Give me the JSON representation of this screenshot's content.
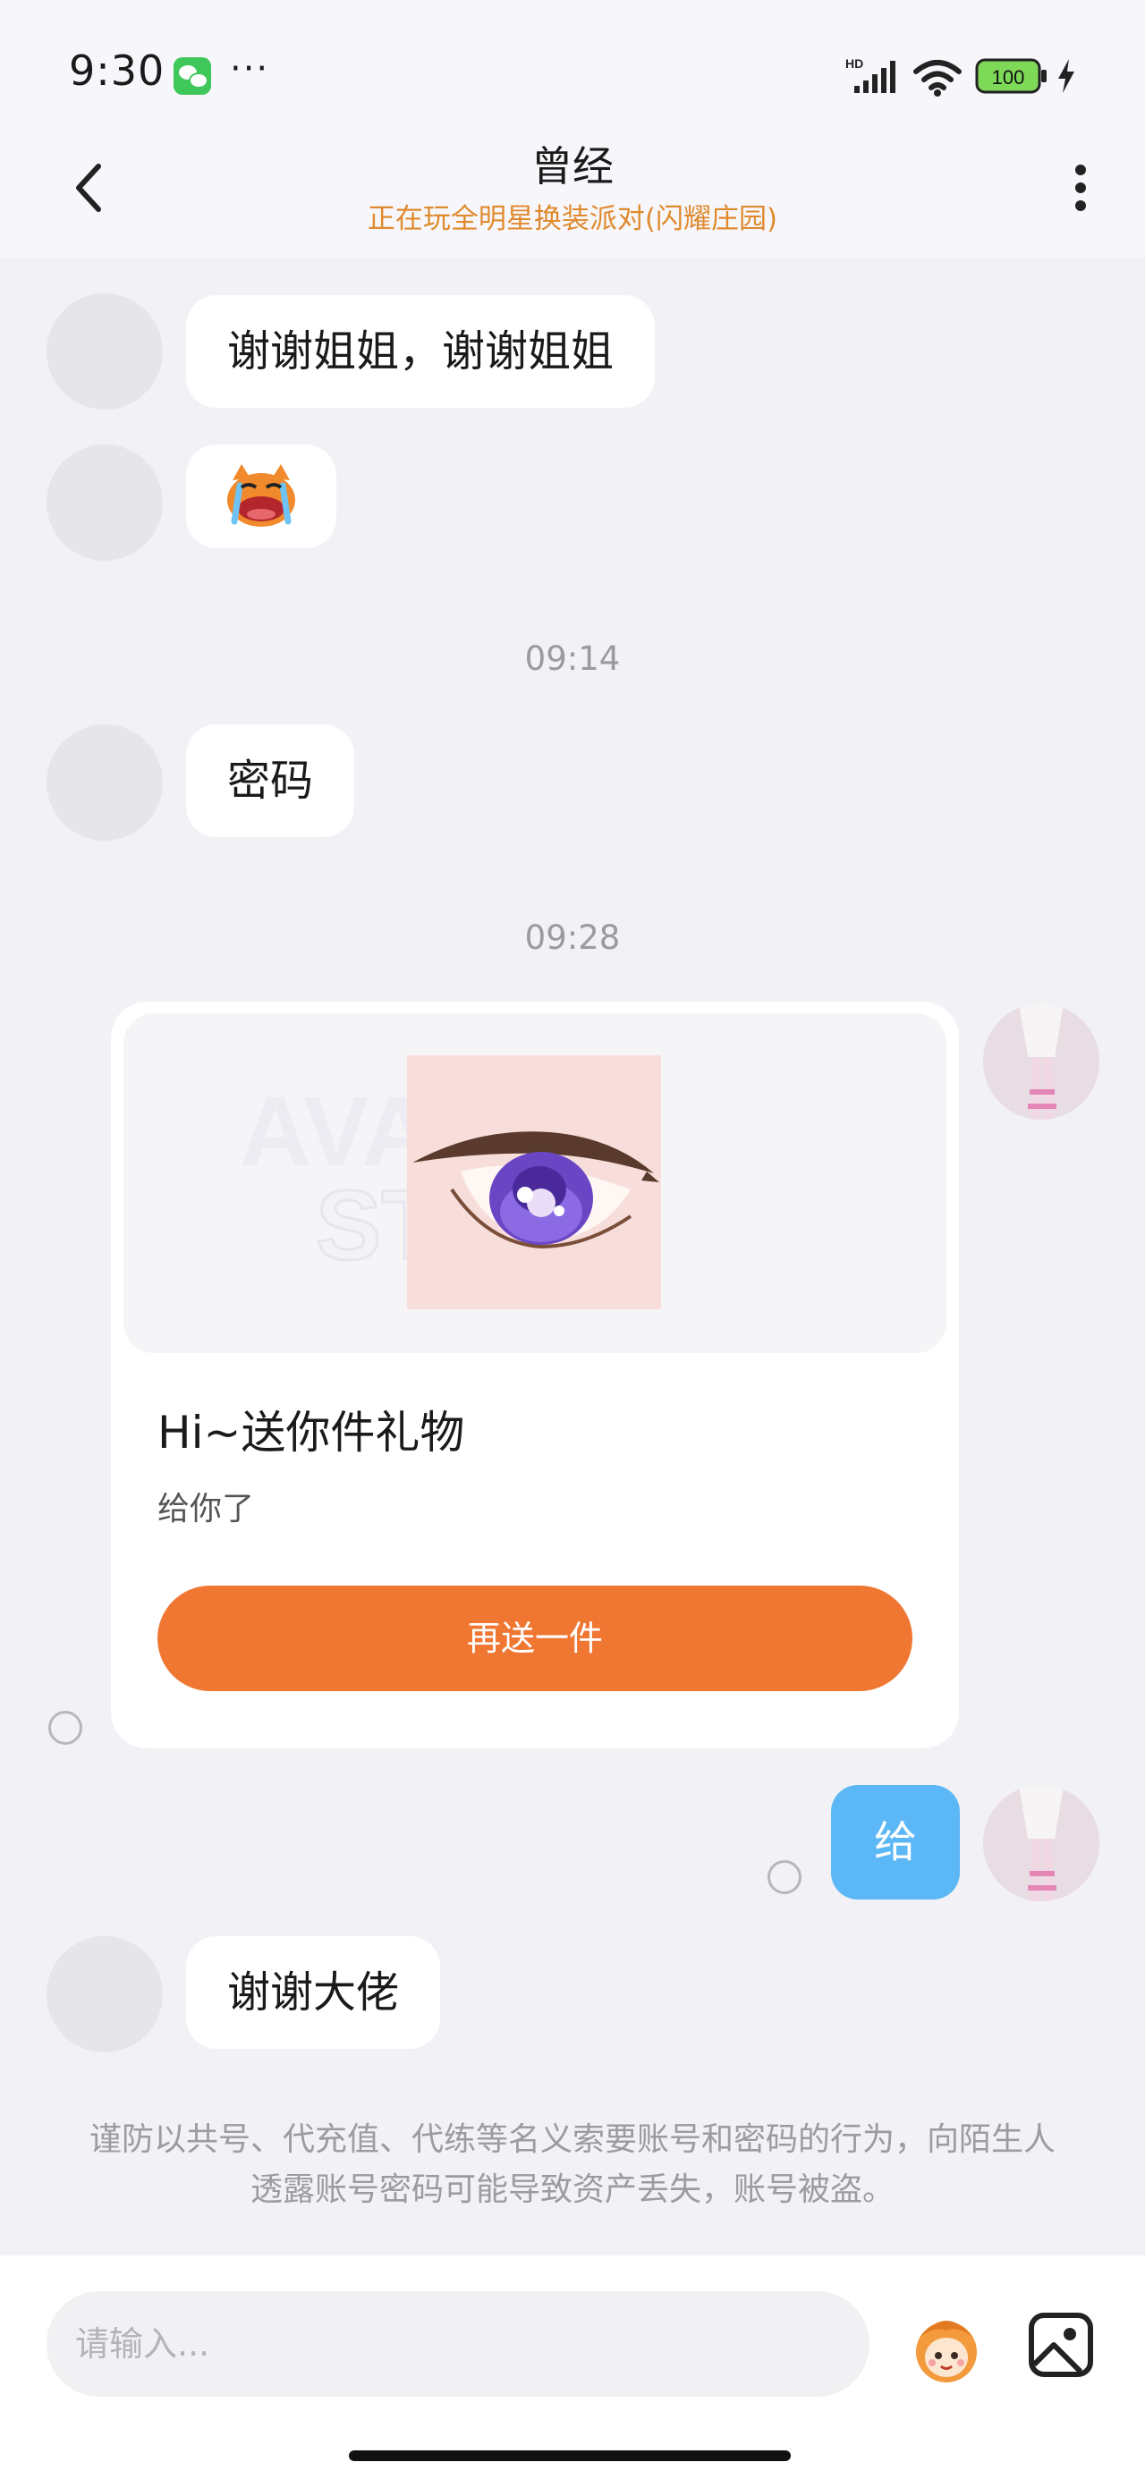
{
  "status_bar": {
    "time": "9:30",
    "dots": "···",
    "network_label": "HD",
    "battery": "100",
    "icons": [
      "wechat-icon",
      "signal-icon",
      "wifi-icon",
      "battery-icon",
      "charging-icon"
    ]
  },
  "header": {
    "title": "曾经",
    "subtitle": "正在玩全明星换装派对(闪耀庄园)"
  },
  "messages": {
    "m1": "谢谢姐姐，谢谢姐姐",
    "t1": "09:14",
    "m3": "密码",
    "t2": "09:28",
    "gift": {
      "title": "Hi~送你件礼物",
      "desc": "给你了",
      "button": "再送一件",
      "watermark_line1": "AVATAR",
      "watermark_line2": "STORE"
    },
    "me": "给",
    "m5": "谢谢大佬"
  },
  "notice": "谨防以共号、代充值、代练等名义索要账号和密码的行为，向陌生人透露账号密码可能导致资产丢失，账号被盗。",
  "input": {
    "placeholder": "请输入..."
  },
  "colors": {
    "accent": "#ef7732",
    "subtitle": "#e08a2e",
    "my_bubble": "#5bb7f5",
    "background": "#f1f1f6"
  }
}
